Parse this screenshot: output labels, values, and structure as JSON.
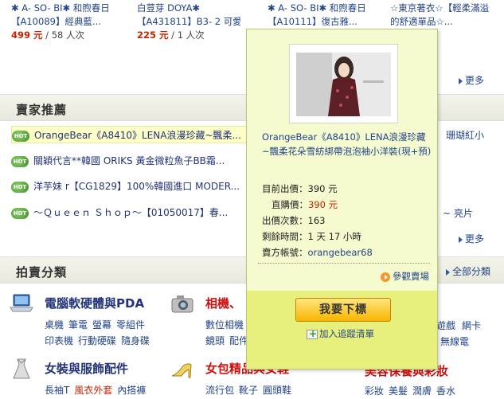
{
  "top_products": [
    {
      "line1": "✱ A- SO- BI✱ 和煦春日",
      "line2": "【A10089】經典藍...",
      "price": "499 元",
      "count": " / 58 人次"
    },
    {
      "line1": "白荳芽  DOYA✱",
      "line2": "【A431811】B3- 2 可愛甜...",
      "price": "225 元",
      "count": " / 1 人次"
    },
    {
      "line1": "✱ A- SO- BI✱ 和煦春日",
      "line2": "【A10111】復古雅...",
      "price": "",
      "count": ""
    },
    {
      "line1": "☆東京著衣☆【輕柔滿溢",
      "line2": "的舒適單品☆...",
      "price": "",
      "count": ""
    }
  ],
  "more_label": "更多",
  "seller_section_title": "賣家推薦",
  "seller_items": [
    {
      "text": "OrangeBear《A8410》LENA浪漫珍藏~飄柔..."
    },
    {
      "text": "關穎代言**韓國  ORIKS 黃金微粒魚子BB霜..."
    },
    {
      "text": "洋芋妹 r【CG1829】100%韓國進口 MODER..."
    },
    {
      "text": "～Ｑｕｅｅｎ Ｓｈｏｐ～【01050017】春..."
    }
  ],
  "right_fragments": {
    "r1": "珊瑚紅小",
    "r2": "~ 亮片"
  },
  "category_section_title": "拍賣分類",
  "all_categories_label": "全部分類",
  "categories": [
    {
      "name": "電腦軟硬體與PDA",
      "subs": [
        [
          "桌機",
          "筆電",
          "螢幕",
          "零組件"
        ],
        [
          "印表機",
          "行動硬碟",
          "隨身碟"
        ]
      ]
    },
    {
      "name": "相機、",
      "subs": [
        [
          "數位相機"
        ],
        [
          "鏡頭",
          "配件"
        ]
      ]
    },
    {
      "name": "女裝與服飾配件",
      "subs": [
        [
          "長袖T",
          "風衣外套",
          "內搭褲"
        ]
      ]
    },
    {
      "name": "女包精品與女鞋",
      "subs": [
        [
          "流行包",
          "靴子",
          "圓頭鞋"
        ]
      ]
    }
  ],
  "right_cat_fragments": {
    "a": "遊戲",
    "b": "網卡",
    "c": "無線電",
    "d": "美容保養與彩妝",
    "e": "彩妝",
    "f": "美髮",
    "g": "潤膚",
    "h": "香水"
  },
  "popup": {
    "title": "OrangeBear《A8410》LENA浪漫珍藏~飄柔花朵雪紡綁帶泡泡袖小洋裝(現+預)",
    "current_bid_label": "目前出價：",
    "current_bid": "390 元",
    "buy_now_label": "直購價：",
    "buy_now": "390 元",
    "bids_label": "出價次數：",
    "bids": "163",
    "time_left_label": "剩餘時間：",
    "time_left": "1 天  17 小時",
    "seller_label": "賣方帳號：",
    "seller": "orangebear68",
    "visit_label": "參觀賣場",
    "bid_button": "我要下標",
    "track_label": "加入追蹤清單"
  }
}
